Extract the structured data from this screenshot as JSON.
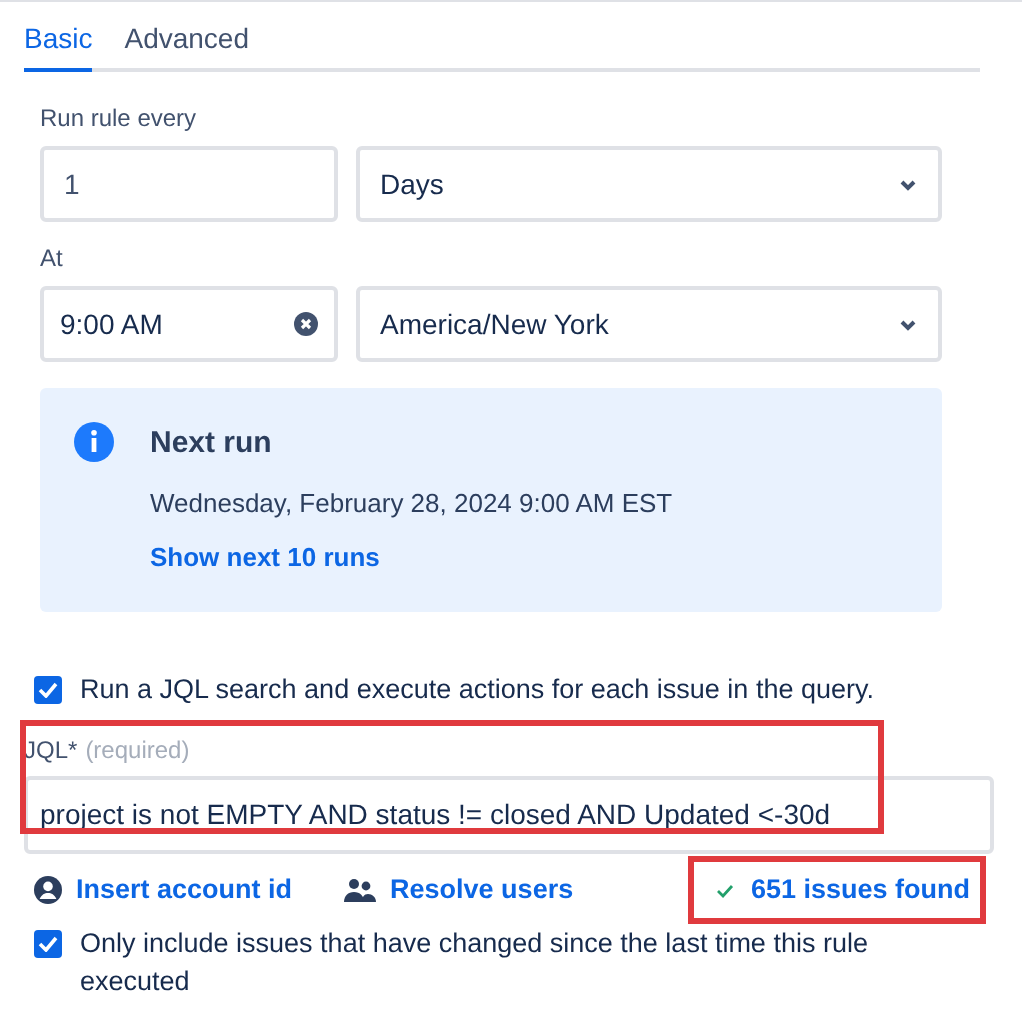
{
  "tabs": [
    {
      "label": "Basic",
      "selected": true
    },
    {
      "label": "Advanced",
      "selected": false
    }
  ],
  "schedule": {
    "every_label": "Run rule every",
    "every_value": "1",
    "unit": "Days",
    "at_label": "At",
    "time": "9:00 AM",
    "timezone": "America/New York"
  },
  "next_run": {
    "title": "Next run",
    "date": "Wednesday, February 28, 2024 9:00 AM EST",
    "link": "Show next 10 runs"
  },
  "jql_search": {
    "label": "Run a JQL search and execute actions for each issue in the query.",
    "checked": true
  },
  "jql": {
    "label": "JQL",
    "required_mark": "*",
    "hint": "(required)",
    "value": "project is not EMPTY AND status != closed AND Updated <-30d"
  },
  "links": [
    {
      "kind": "account",
      "label": "Insert account id"
    },
    {
      "kind": "users",
      "label": "Resolve users"
    }
  ],
  "result": {
    "label": "651 issues found"
  },
  "changed_only": {
    "label": "Only include issues that have changed since the last time this rule executed",
    "checked": true
  },
  "annotations": [
    {
      "kind": "highlight"
    },
    {
      "kind": "highlight"
    }
  ]
}
